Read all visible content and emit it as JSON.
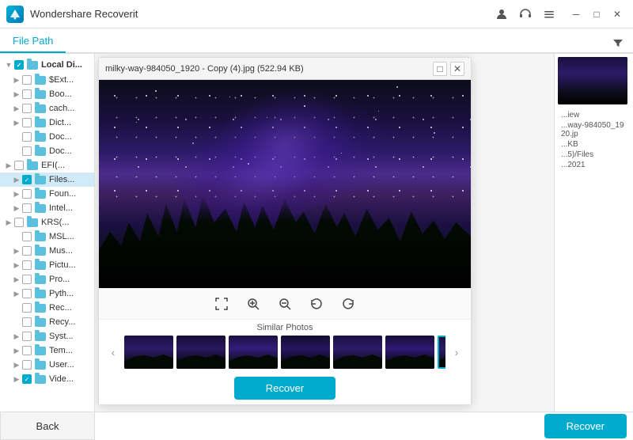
{
  "app": {
    "title": "Wondershare Recoverit",
    "logo_letter": "W"
  },
  "title_bar": {
    "minimize_label": "─",
    "maximize_label": "□",
    "close_label": "✕"
  },
  "tabs": {
    "file_path_label": "File Path"
  },
  "sidebar": {
    "root_label": "Local Di...",
    "items": [
      {
        "label": "$Ext...",
        "indent": 1
      },
      {
        "label": "Boo...",
        "indent": 1
      },
      {
        "label": "cach...",
        "indent": 1
      },
      {
        "label": "Dict...",
        "indent": 1
      },
      {
        "label": "Doc...",
        "indent": 1
      },
      {
        "label": "Doc...",
        "indent": 1
      },
      {
        "label": "EFI(...",
        "indent": 0
      },
      {
        "label": "Files...",
        "indent": 1,
        "highlighted": true
      },
      {
        "label": "Foun...",
        "indent": 1
      },
      {
        "label": "Intel...",
        "indent": 1
      },
      {
        "label": "KRS(...",
        "indent": 0
      },
      {
        "label": "MSL...",
        "indent": 1
      },
      {
        "label": "Mus...",
        "indent": 1
      },
      {
        "label": "Pictu...",
        "indent": 1
      },
      {
        "label": "Pro...",
        "indent": 1
      },
      {
        "label": "Pyth...",
        "indent": 1
      },
      {
        "label": "Rec...",
        "indent": 1
      },
      {
        "label": "Recy...",
        "indent": 1
      },
      {
        "label": "Syst...",
        "indent": 1
      },
      {
        "label": "Tem...",
        "indent": 1
      },
      {
        "label": "User...",
        "indent": 1
      },
      {
        "label": "Vide...",
        "indent": 1
      }
    ],
    "back_label": "Back"
  },
  "modal": {
    "title": "milky-way-984050_1920 - Copy (4).jpg (522.94 KB)",
    "maximize_icon": "□",
    "close_icon": "✕"
  },
  "image_controls": {
    "fullscreen_icon": "⛶",
    "zoom_in_icon": "⊕",
    "zoom_out_icon": "⊖",
    "rotate_left_icon": "↺",
    "rotate_right_icon": "↻"
  },
  "similar_photos": {
    "label": "Similar Photos",
    "prev_icon": "‹",
    "next_icon": "›",
    "thumbnail_count": 7
  },
  "modal_recover": {
    "label": "Recover"
  },
  "right_panel": {
    "preview_label": "...iew",
    "filename": "...way-984050_1920.jp",
    "filesize": "...KB",
    "filepath": "...5)/Files",
    "date": "...2021"
  },
  "bottom": {
    "recover_label": "Recover"
  }
}
